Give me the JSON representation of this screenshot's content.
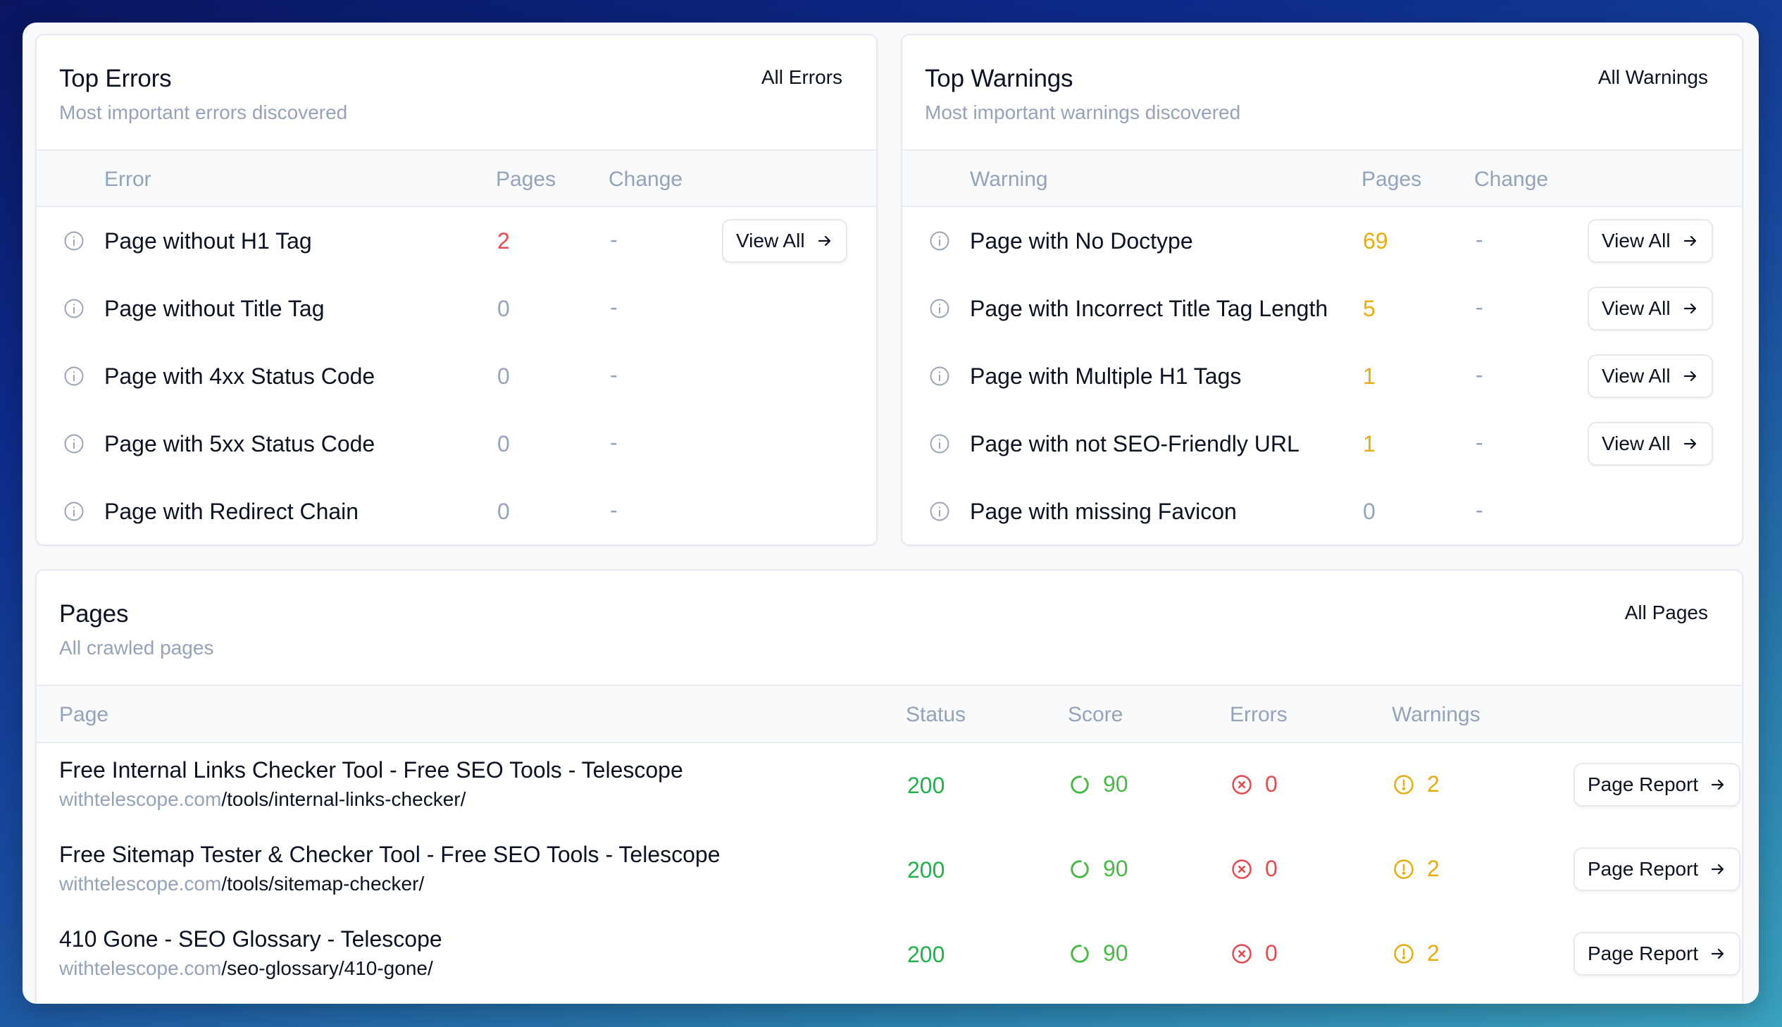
{
  "colors": {
    "error_red": "#e5484d",
    "warning_amber": "#e6ac12",
    "success_green": "#22b04b",
    "score_green": "#4cb847",
    "muted_gray": "#94a3b8",
    "text_dark": "#0b1222"
  },
  "top_errors": {
    "title": "Top Errors",
    "subtitle": "Most important errors discovered",
    "link_label": "All Errors",
    "columns": [
      "Error",
      "Pages",
      "Change"
    ],
    "rows": [
      {
        "icon": "info-icon",
        "label": "Page without H1 Tag",
        "pages": "2",
        "change": "-",
        "button": "View All",
        "severity": "error"
      },
      {
        "icon": "info-icon",
        "label": "Page without Title Tag",
        "pages": "0",
        "change": "-",
        "button": null,
        "severity": "none"
      },
      {
        "icon": "info-icon",
        "label": "Page with 4xx Status Code",
        "pages": "0",
        "change": "-",
        "button": null,
        "severity": "none"
      },
      {
        "icon": "info-icon",
        "label": "Page with 5xx Status Code",
        "pages": "0",
        "change": "-",
        "button": null,
        "severity": "none"
      },
      {
        "icon": "info-icon",
        "label": "Page with Redirect Chain",
        "pages": "0",
        "change": "-",
        "button": null,
        "severity": "none"
      }
    ]
  },
  "top_warnings": {
    "title": "Top Warnings",
    "subtitle": "Most important warnings discovered",
    "link_label": "All Warnings",
    "columns": [
      "Warning",
      "Pages",
      "Change"
    ],
    "rows": [
      {
        "icon": "info-icon",
        "label": "Page with No Doctype",
        "pages": "69",
        "change": "-",
        "button": "View All",
        "severity": "warning"
      },
      {
        "icon": "info-icon",
        "label": "Page with Incorrect Title Tag Length",
        "pages": "5",
        "change": "-",
        "button": "View All",
        "severity": "warning"
      },
      {
        "icon": "info-icon",
        "label": "Page with Multiple H1 Tags",
        "pages": "1",
        "change": "-",
        "button": "View All",
        "severity": "warning"
      },
      {
        "icon": "info-icon",
        "label": "Page with not SEO-Friendly URL",
        "pages": "1",
        "change": "-",
        "button": "View All",
        "severity": "warning"
      },
      {
        "icon": "info-icon",
        "label": "Page with missing Favicon",
        "pages": "0",
        "change": "-",
        "button": null,
        "severity": "none"
      }
    ]
  },
  "pages": {
    "title": "Pages",
    "subtitle": "All crawled pages",
    "link_label": "All Pages",
    "columns": [
      "Page",
      "Status",
      "Score",
      "Errors",
      "Warnings"
    ],
    "rows": [
      {
        "title": "Free Internal Links Checker Tool - Free SEO Tools - Telescope",
        "host": "withtelescope.com",
        "path": "/tools/internal-links-checker/",
        "status": "200",
        "score": "90",
        "score_fraction": 0.9,
        "errors": "0",
        "warnings": "2",
        "button": "Page Report"
      },
      {
        "title": "Free Sitemap Tester & Checker Tool - Free SEO Tools - Telescope",
        "host": "withtelescope.com",
        "path": "/tools/sitemap-checker/",
        "status": "200",
        "score": "90",
        "score_fraction": 0.9,
        "errors": "0",
        "warnings": "2",
        "button": "Page Report"
      },
      {
        "title": "410 Gone - SEO Glossary - Telescope",
        "host": "withtelescope.com",
        "path": "/seo-glossary/410-gone/",
        "status": "200",
        "score": "90",
        "score_fraction": 0.9,
        "errors": "0",
        "warnings": "2",
        "button": "Page Report"
      }
    ]
  }
}
